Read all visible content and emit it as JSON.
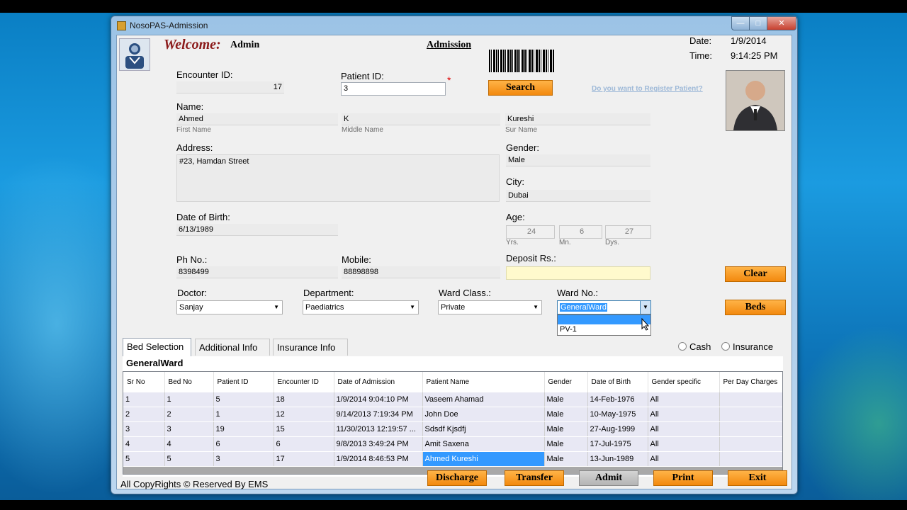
{
  "window": {
    "title": "NosoPAS-Admission"
  },
  "header": {
    "welcome": "Welcome:",
    "user": "Admin",
    "form_title": "Admission",
    "date_label": "Date:",
    "date_value": "1/9/2014",
    "time_label": "Time:",
    "time_value": "9:14:25 PM",
    "register_link": "Do you want to Register Patient?"
  },
  "form": {
    "encounter_id_label": "Encounter ID:",
    "encounter_id": "17",
    "patient_id_label": "Patient ID:",
    "patient_id": "3",
    "required_mark": "*",
    "search_button": "Search",
    "name_label": "Name:",
    "first_name": "Ahmed",
    "first_name_caption": "First Name",
    "middle_name": "K",
    "middle_name_caption": "Middle Name",
    "sur_name": "Kureshi",
    "sur_name_caption": "Sur Name",
    "address_label": "Address:",
    "address": "#23, Hamdan Street",
    "gender_label": "Gender:",
    "gender": "Male",
    "city_label": "City:",
    "city": "Dubai",
    "dob_label": "Date of Birth:",
    "dob": "6/13/1989",
    "age_label": "Age:",
    "age_years": "24",
    "age_years_caption": "Yrs.",
    "age_months": "6",
    "age_months_caption": "Mn.",
    "age_days": "27",
    "age_days_caption": "Dys.",
    "phone_label": "Ph No.:",
    "phone": "8398499",
    "mobile_label": "Mobile:",
    "mobile": "88898898",
    "deposit_label": "Deposit Rs.:",
    "deposit": "",
    "doctor_label": "Doctor:",
    "doctor": "Sanjay",
    "department_label": "Department:",
    "department": "Paediatrics",
    "ward_class_label": "Ward Class.:",
    "ward_class": "Private",
    "ward_no_label": "Ward No.:",
    "ward_no": "GeneralWard",
    "ward_no_options": [
      "",
      "PV-1"
    ],
    "payment_cash": "Cash",
    "payment_insurance": "Insurance"
  },
  "side_buttons": {
    "clear": "Clear",
    "beds": "Beds"
  },
  "tabs": [
    {
      "label": "Bed Selection",
      "active": true
    },
    {
      "label": "Additional Info",
      "active": false
    },
    {
      "label": "Insurance Info",
      "active": false
    }
  ],
  "bed_panel": {
    "ward_title": "GeneralWard",
    "columns": [
      "Sr No",
      "Bed No",
      "Patient ID",
      "Encounter ID",
      "Date of Admission",
      "Patient Name",
      "Gender",
      "Date of Birth",
      "Gender specific",
      "Per Day Charges"
    ],
    "rows": [
      [
        "1",
        "1",
        "5",
        "18",
        "1/9/2014 9:04:10 PM",
        "Vaseem Ahamad",
        "Male",
        "14-Feb-1976",
        "All",
        ""
      ],
      [
        "2",
        "2",
        "1",
        "12",
        "9/14/2013 7:19:34 PM",
        "John Doe",
        "Male",
        "10-May-1975",
        "All",
        ""
      ],
      [
        "3",
        "3",
        "19",
        "15",
        "11/30/2013 12:19:57 ...",
        "Sdsdf Kjsdfj",
        "Male",
        "27-Aug-1999",
        "All",
        ""
      ],
      [
        "4",
        "4",
        "6",
        "6",
        "9/8/2013 3:49:24 PM",
        "Amit Saxena",
        "Male",
        "17-Jul-1975",
        "All",
        ""
      ],
      [
        "5",
        "5",
        "3",
        "17",
        "1/9/2014 8:46:53 PM",
        "Ahmed Kureshi",
        "Male",
        "13-Jun-1989",
        "All",
        ""
      ]
    ],
    "selected_row": 4
  },
  "footer": {
    "copyright": "All CopyRights © Reserved By EMS",
    "buttons": {
      "discharge": "Discharge",
      "transfer": "Transfer",
      "admit": "Admit",
      "print": "Print",
      "exit": "Exit"
    }
  },
  "colors": {
    "accent_button": "#f2890e",
    "deposit_field": "#fffacd",
    "selection": "#3399ff",
    "desktop": "#1b9be0"
  }
}
